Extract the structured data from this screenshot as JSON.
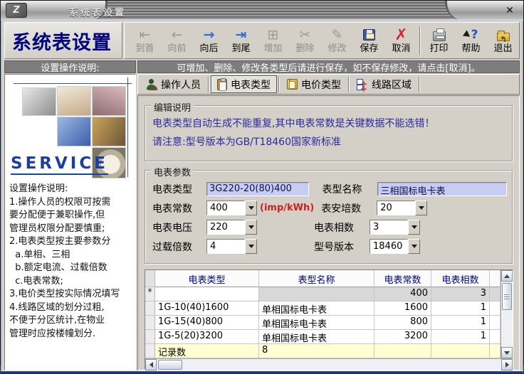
{
  "titlebar": {
    "title": "系统表设置",
    "logo_glyph": "Z",
    "close": "✕"
  },
  "logo_title": "系统表设置",
  "toolbar": {
    "buttons": [
      {
        "label": "到首",
        "glyph": "⇤",
        "enabled": false
      },
      {
        "label": "向前",
        "glyph": "←",
        "enabled": false
      },
      {
        "label": "向后",
        "glyph": "→",
        "enabled": true
      },
      {
        "label": "到尾",
        "glyph": "⇥",
        "enabled": true
      },
      {
        "label": "增加",
        "glyph": "⊞",
        "enabled": false
      },
      {
        "label": "删除",
        "glyph": "✂",
        "enabled": false
      },
      {
        "label": "修改",
        "glyph": "✎",
        "enabled": false
      },
      {
        "label": "保存",
        "glyph": "",
        "enabled": true
      },
      {
        "label": "取消",
        "glyph": "✗",
        "enabled": true
      },
      {
        "label": "打印",
        "glyph": "",
        "enabled": true
      },
      {
        "label": "帮助",
        "glyph": "?",
        "enabled": true
      },
      {
        "label": "退出",
        "glyph": "",
        "enabled": true
      }
    ]
  },
  "captions": {
    "sidebar": "设置操作说明:",
    "main": "可增加、删除、修改各类型后请进行保存，如不保存修改，请点击[取消]。"
  },
  "sidebar": {
    "service": "SERVICE",
    "instructions": [
      "设置操作说明:",
      "1.操作人员的权限可按需",
      "要分配便于兼职操作,但",
      "管理员权限分配要慎重;",
      "2.电表类型按主要参数分",
      "  a.单相、三相",
      "  b.额定电流、过载倍数",
      "  c.电表常数;",
      "3.电价类型按实际情况填写",
      "4.线路区域的划分过粗,",
      "不便于分区统计,在物业",
      "管理时应按楼幢划分."
    ]
  },
  "tabs": [
    {
      "label": "操作人员",
      "active": false
    },
    {
      "label": "电表类型",
      "active": true
    },
    {
      "label": "电价类型",
      "active": false
    },
    {
      "label": "线路区域",
      "active": false
    }
  ],
  "edit_note": {
    "title": "编辑说明",
    "line1": "电表类型自动生成不能重复,其中电表常数是关键数据不能选错！",
    "line2": "请注意:型号版本为GB/T18460国家新标准"
  },
  "params": {
    "title": "电表参数",
    "meter_type": {
      "label": "电表类型",
      "value": "3G220-20(80)400"
    },
    "model_name": {
      "label": "表型名称",
      "value": "三相国标电卡表"
    },
    "meter_constant": {
      "label": "电表常数",
      "value": "400",
      "unit": "(imp/kWh)"
    },
    "amperage": {
      "label": "表安培数",
      "value": "20"
    },
    "voltage": {
      "label": "电表电压",
      "value": "220"
    },
    "phases": {
      "label": "电表相数",
      "value": "3"
    },
    "overload": {
      "label": "过载倍数",
      "value": "4"
    },
    "version": {
      "label": "型号版本",
      "value": "18460"
    }
  },
  "grid": {
    "columns": [
      "电表类型",
      "表型名称",
      "电表常数",
      "电表相数"
    ],
    "new_row_marker": "*",
    "rows": [
      {
        "type": "",
        "name": "",
        "constant": "400",
        "phases": "3"
      },
      {
        "type": "1G-10(40)1600",
        "name": "单相国标电卡表",
        "constant": "1600",
        "phases": "1"
      },
      {
        "type": "1G-15(40)800",
        "name": "单相国标电卡表",
        "constant": "800",
        "phases": "1"
      },
      {
        "type": "1G-5(20)3200",
        "name": "单相国标电卡表",
        "constant": "3200",
        "phases": "1"
      }
    ],
    "footer": {
      "label": "记录数",
      "value": "8"
    }
  }
}
